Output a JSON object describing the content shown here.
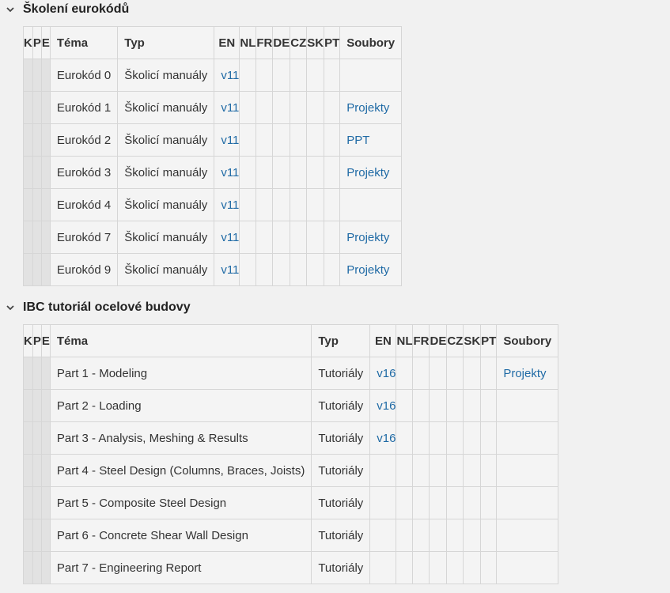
{
  "sections": [
    {
      "title": "Školení eurokódů",
      "columns": [
        "K",
        "P",
        "E",
        "Téma",
        "Typ",
        "EN",
        "NL",
        "FR",
        "DE",
        "CZ",
        "SK",
        "PT",
        "Soubory"
      ],
      "rows": [
        {
          "tema": "Eurokód 0",
          "typ": "Školicí manuály",
          "en": "v11",
          "soubory": ""
        },
        {
          "tema": "Eurokód 1",
          "typ": "Školicí manuály",
          "en": "v11",
          "soubory": "Projekty"
        },
        {
          "tema": "Eurokód 2",
          "typ": "Školicí manuály",
          "en": "v11",
          "soubory": "PPT"
        },
        {
          "tema": "Eurokód 3",
          "typ": "Školicí manuály",
          "en": "v11",
          "soubory": "Projekty"
        },
        {
          "tema": "Eurokód 4",
          "typ": "Školicí manuály",
          "en": "v11",
          "soubory": ""
        },
        {
          "tema": "Eurokód 7",
          "typ": "Školicí manuály",
          "en": "v11",
          "soubory": "Projekty"
        },
        {
          "tema": "Eurokód 9",
          "typ": "Školicí manuály",
          "en": "v11",
          "soubory": "Projekty"
        }
      ]
    },
    {
      "title": "IBC tutoriál ocelové budovy",
      "columns": [
        "K",
        "P",
        "E",
        "Téma",
        "Typ",
        "EN",
        "NL",
        "FR",
        "DE",
        "CZ",
        "SK",
        "PT",
        "Soubory"
      ],
      "rows": [
        {
          "tema": "Part 1 - Modeling",
          "typ": "Tutoriály",
          "en": "v16",
          "soubory": "Projekty"
        },
        {
          "tema": "Part 2 - Loading",
          "typ": "Tutoriály",
          "en": "v16",
          "soubory": ""
        },
        {
          "tema": "Part 3 - Analysis, Meshing & Results",
          "typ": "Tutoriály",
          "en": "v16",
          "soubory": ""
        },
        {
          "tema": "Part 4 - Steel Design (Columns, Braces, Joists)",
          "typ": "Tutoriály",
          "en": "",
          "soubory": ""
        },
        {
          "tema": "Part 5 - Composite Steel Design",
          "typ": "Tutoriály",
          "en": "",
          "soubory": ""
        },
        {
          "tema": "Part 6 - Concrete Shear Wall Design",
          "typ": "Tutoriály",
          "en": "",
          "soubory": ""
        },
        {
          "tema": "Part 7 - Engineering Report",
          "typ": "Tutoriály",
          "en": "",
          "soubory": ""
        }
      ]
    }
  ],
  "colors": {
    "link": "#1f6aa5",
    "kpe_cell": "#e2e2e2",
    "border": "#d6d6d6"
  },
  "icons": {
    "section_toggle": "chevron-down-icon"
  }
}
